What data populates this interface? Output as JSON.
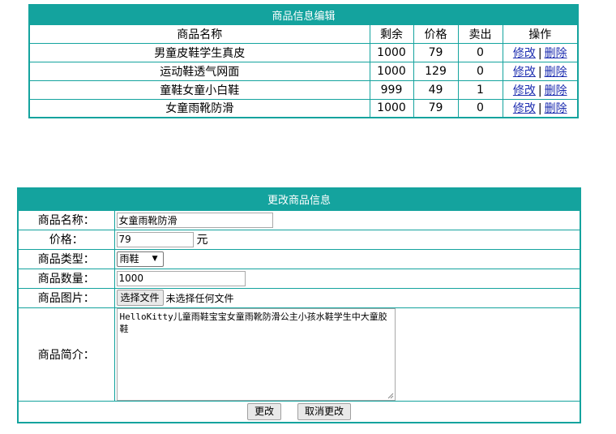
{
  "list": {
    "title": "商品信息编辑",
    "headers": [
      "商品名称",
      "剩余",
      "价格",
      "卖出",
      "操作"
    ],
    "rows": [
      {
        "name": "男童皮鞋学生真皮",
        "stock": "1000",
        "price": "79",
        "sold": "0"
      },
      {
        "name": "运动鞋透气网面",
        "stock": "1000",
        "price": "129",
        "sold": "0"
      },
      {
        "name": "童鞋女童小白鞋",
        "stock": "999",
        "price": "49",
        "sold": "1"
      },
      {
        "name": "女童雨靴防滑",
        "stock": "1000",
        "price": "79",
        "sold": "0"
      }
    ],
    "edit_label": "修改",
    "delete_label": "删除",
    "separator": "|"
  },
  "form": {
    "title": "更改商品信息",
    "name_label": "商品名称：",
    "name_value": "女童雨靴防滑",
    "price_label": "价格：",
    "price_value": "79",
    "price_unit": "元",
    "type_label": "商品类型：",
    "type_value": "雨鞋",
    "quantity_label": "商品数量：",
    "quantity_value": "1000",
    "image_label": "商品图片：",
    "file_button": "选择文件",
    "file_status": "未选择任何文件",
    "desc_label": "商品简介：",
    "desc_value": "HelloKitty儿童雨鞋宝宝女童雨靴防滑公主小孩水鞋学生中大童胶鞋",
    "submit_label": "更改",
    "cancel_label": "取消更改"
  }
}
